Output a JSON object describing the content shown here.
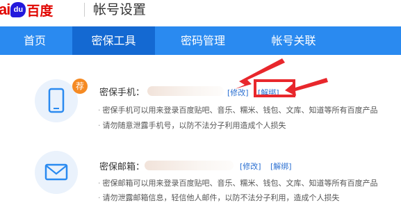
{
  "header": {
    "logo": {
      "part1": "ai",
      "part2": "du",
      "part3": "百度"
    },
    "title": "帐号设置"
  },
  "nav": {
    "items": [
      {
        "label": "首页"
      },
      {
        "label": "密保工具"
      },
      {
        "label": "密码管理"
      },
      {
        "label": "帐号关联"
      }
    ],
    "active_index": 1
  },
  "phone": {
    "icon": "phone-icon",
    "badge": "荐",
    "label": "密保手机：",
    "value_masked": true,
    "modify_link": "[修改]",
    "unbind_link": "[解绑]",
    "desc1": "密保手机可以用来登录百度贴吧、音乐、糯米、钱包、文库、知道等所有百度产品",
    "desc2": "请勿随意泄露手机号，以防不法分子利用造成个人损失"
  },
  "email": {
    "icon": "mail-icon",
    "label": "密保邮箱：",
    "value_masked": true,
    "modify_link": "[修改]",
    "unbind_link": "[解绑]",
    "desc1": "密保邮箱可以用来登录百度贴吧、音乐、糯米、钱包、文库、知道等所有百度产品",
    "desc2": "请勿泄露邮箱信息，轻信他人邮件，以防不法分子利用，造成个人损失"
  },
  "colors": {
    "nav_bg": "#2a8af0",
    "nav_active": "#1469d2",
    "link": "#2a6fd1",
    "badge": "#f58a23",
    "annotation_red": "#e8272c",
    "brand_red": "#e10601",
    "brand_blue": "#2319dc"
  }
}
